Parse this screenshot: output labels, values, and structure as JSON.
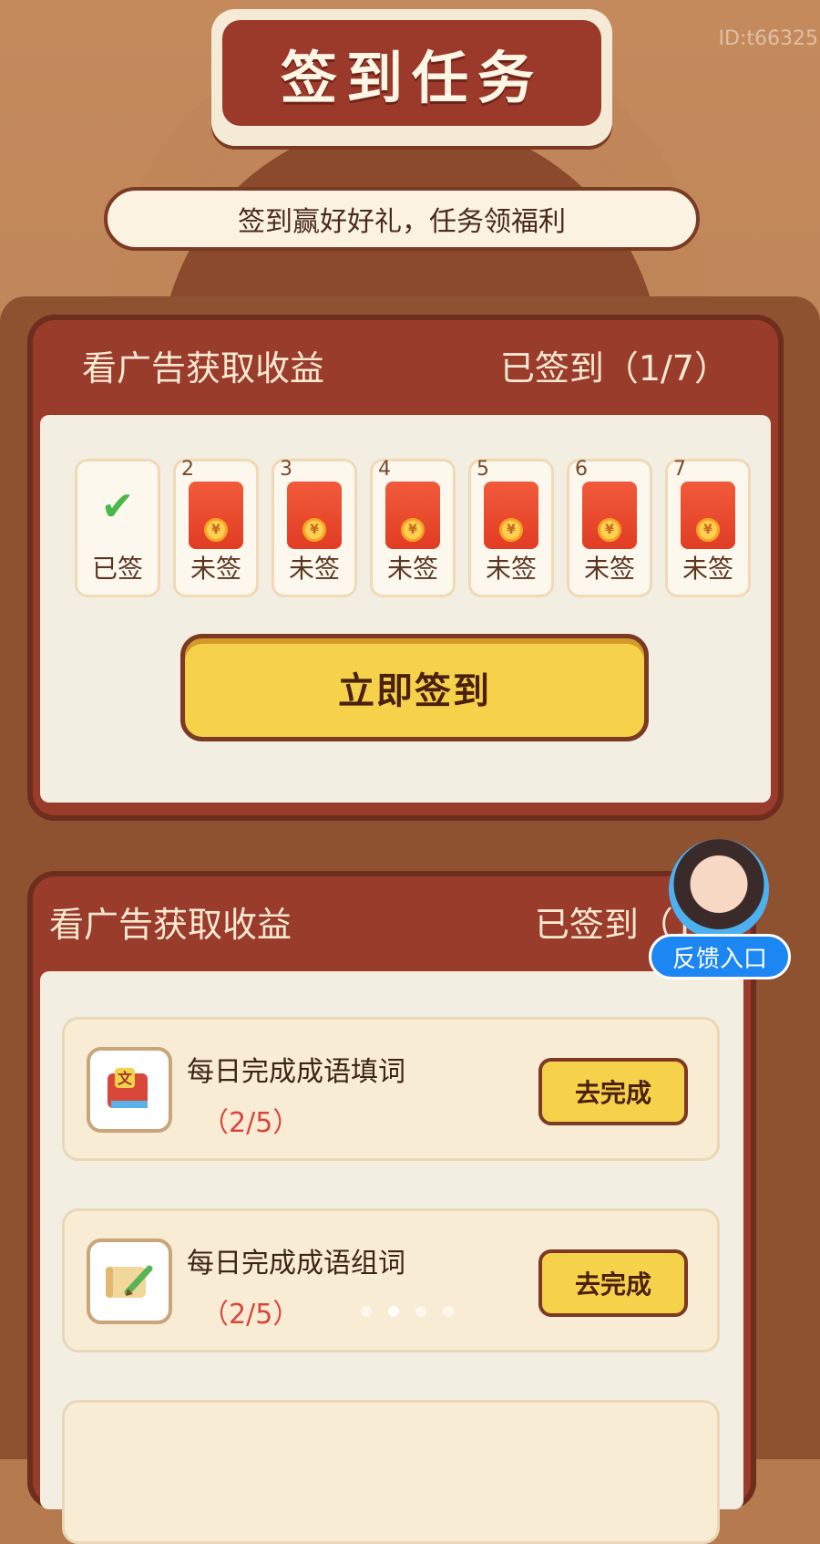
{
  "watermark": "ID:t66325",
  "header": {
    "title": "签到任务",
    "subtitle": "签到赢好好礼，任务领福利"
  },
  "signin_card": {
    "title": "看广告获取收益",
    "status": "已签到（1/7）",
    "days": [
      {
        "number": "",
        "label": "已签",
        "signed": true
      },
      {
        "number": "2",
        "label": "未签",
        "signed": false
      },
      {
        "number": "3",
        "label": "未签",
        "signed": false
      },
      {
        "number": "4",
        "label": "未签",
        "signed": false
      },
      {
        "number": "5",
        "label": "未签",
        "signed": false
      },
      {
        "number": "6",
        "label": "未签",
        "signed": false
      },
      {
        "number": "7",
        "label": "未签",
        "signed": false
      }
    ],
    "coin_symbol": "¥",
    "button_label": "立即签到"
  },
  "task_card": {
    "title": "看广告获取收益",
    "status": "已签到（1/7",
    "tasks": [
      {
        "name": "每日完成成语填词",
        "progress": "（2/5）",
        "button": "去完成",
        "icon": "idiom-book-icon"
      },
      {
        "name": "每日完成成语组词",
        "progress": "（2/5）",
        "button": "去完成",
        "icon": "scroll-pencil-icon"
      }
    ]
  },
  "feedback": {
    "label": "反馈入口",
    "avatar": "support-avatar-icon"
  },
  "colors": {
    "card_red": "#9a3c2c",
    "button_yellow": "#f6d14a",
    "check_green": "#49b84a",
    "progress_red": "#d9463a"
  }
}
